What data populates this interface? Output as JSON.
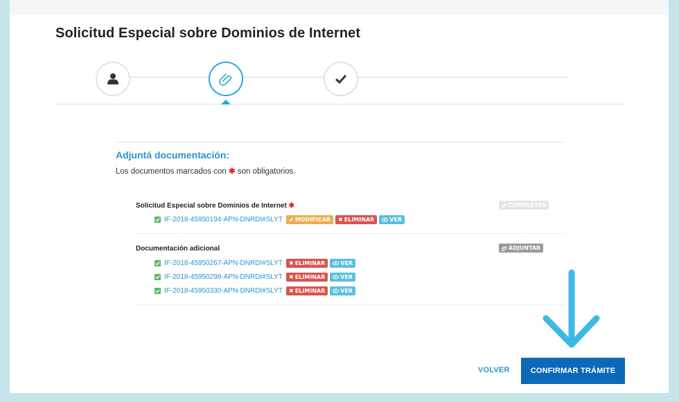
{
  "page": {
    "title": "Solicitud Especial sobre Dominios de Internet"
  },
  "steps": [
    {
      "name": "user-icon",
      "active": false
    },
    {
      "name": "paperclip-icon",
      "active": true
    },
    {
      "name": "check-icon",
      "active": false
    }
  ],
  "section": {
    "title": "Adjuntá documentación:",
    "note_before": "Los documentos marcados con",
    "note_after": "son obligatorios.",
    "required_marker": "✱"
  },
  "required_doc": {
    "title": "Solicitud Especial sobre Dominios de Internet",
    "required_marker": "✱",
    "complete_label": "COMPLETAR",
    "file": {
      "id": "IF-2018-45950194-APN-DNRDI#SLYT",
      "modify_label": "MODIFICAR",
      "delete_label": "ELIMINAR",
      "view_label": "VER"
    }
  },
  "additional_docs": {
    "title": "Documentación adicional",
    "attach_label": "ADJUNTAR",
    "files": [
      {
        "id": "IF-2018-45950267-APN-DNRDI#SLYT",
        "delete_label": "ELIMINAR",
        "view_label": "VER"
      },
      {
        "id": "IF-2018-45950298-APN-DNRDI#SLYT",
        "delete_label": "ELIMINAR",
        "view_label": "VER"
      },
      {
        "id": "IF-2018-45950330-APN-DNRDI#SLYT",
        "delete_label": "ELIMINAR",
        "view_label": "VER"
      }
    ]
  },
  "actions": {
    "back_label": "VOLVER",
    "confirm_label": "CONFIRMAR TRÁMITE"
  },
  "colors": {
    "accent": "#2aa7dd",
    "confirm": "#0b69b7",
    "arrow": "#3cb9e6"
  }
}
